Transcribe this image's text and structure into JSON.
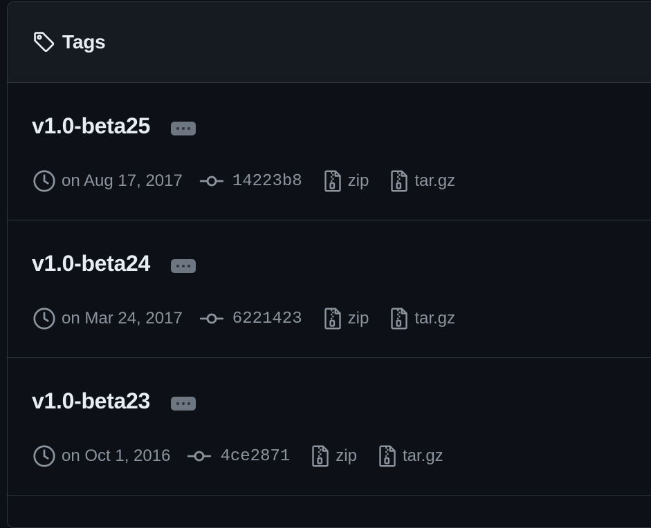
{
  "header": {
    "title": "Tags",
    "icon": "tag-icon"
  },
  "colors": {
    "background": "#0d1117",
    "header_background": "#161b22",
    "border": "#30363d",
    "text_primary": "#e6edf3",
    "text_muted": "#8b949e"
  },
  "tags": [
    {
      "name": "v1.0-beta25",
      "date": "on Aug 17, 2017",
      "commit": "14223b8",
      "zip_label": "zip",
      "targz_label": "tar.gz"
    },
    {
      "name": "v1.0-beta24",
      "date": "on Mar 24, 2017",
      "commit": "6221423",
      "zip_label": "zip",
      "targz_label": "tar.gz"
    },
    {
      "name": "v1.0-beta23",
      "date": "on Oct 1, 2016",
      "commit": "4ce2871",
      "zip_label": "zip",
      "targz_label": "tar.gz"
    }
  ]
}
